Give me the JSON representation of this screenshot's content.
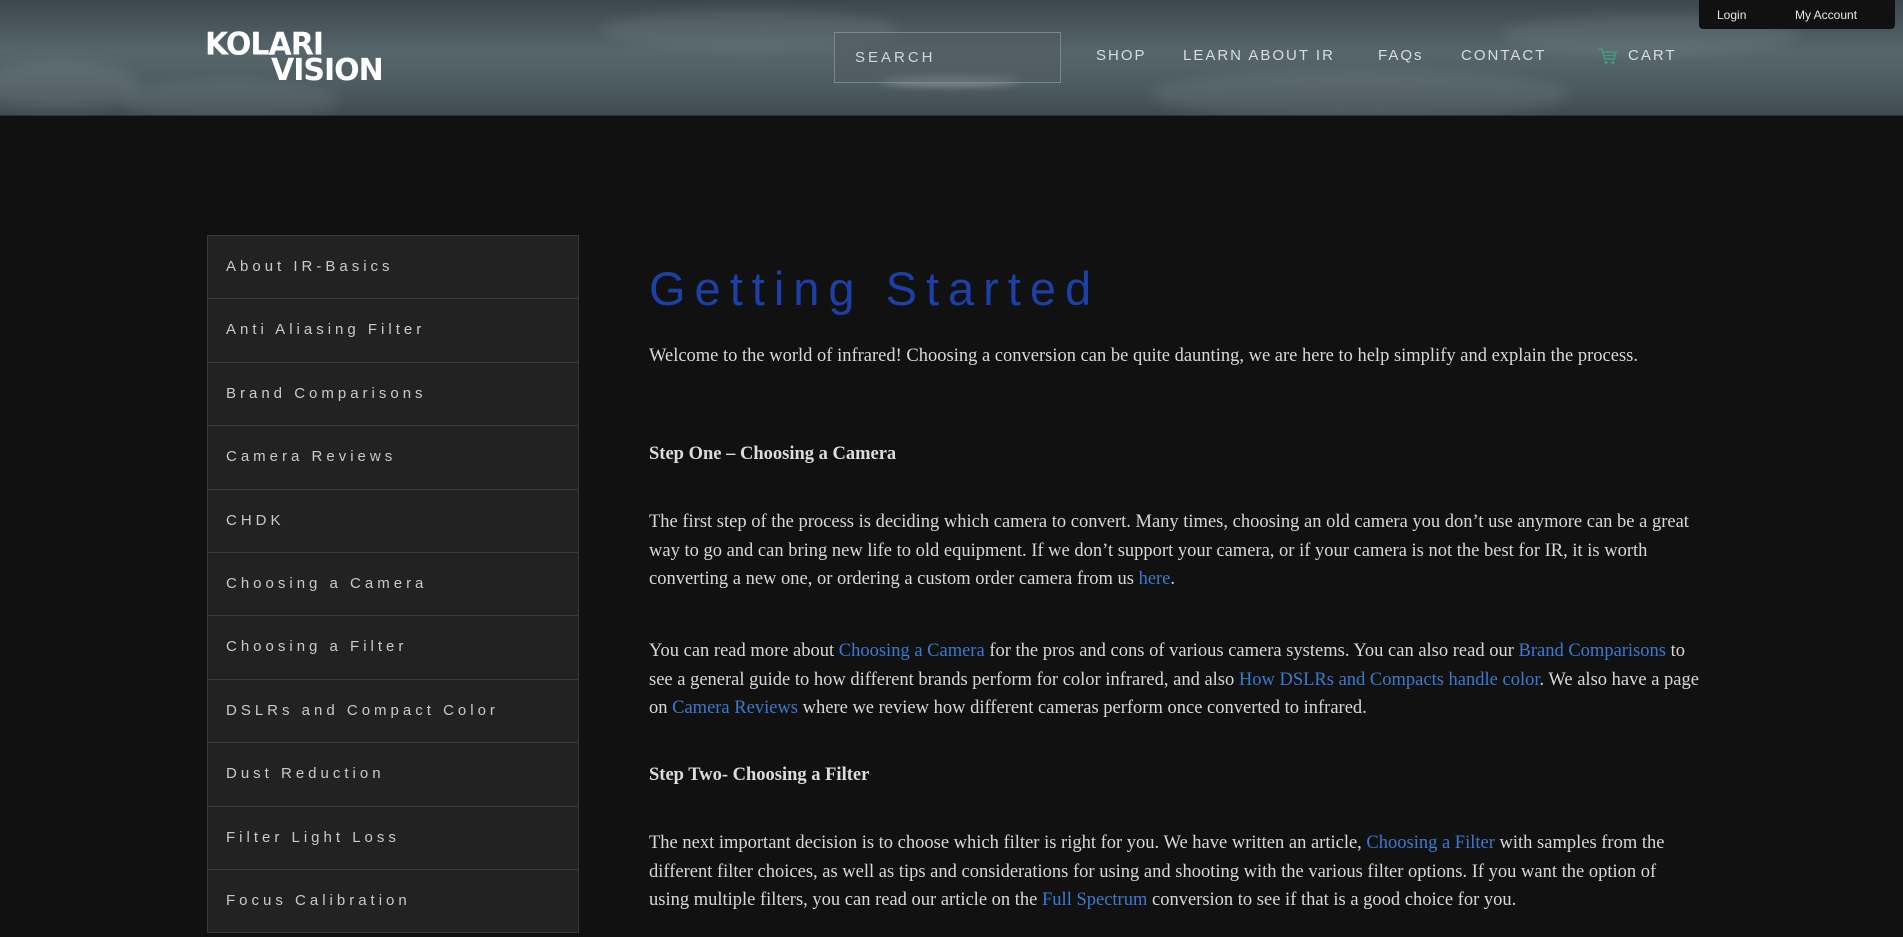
{
  "header": {
    "logo_line1": "KOLARI",
    "logo_line2": "VISION",
    "search_placeholder": "SEARCH",
    "nav": {
      "shop": "SHOP",
      "learn": "LEARN ABOUT IR",
      "faqs": "FAQs",
      "contact": "CONTACT",
      "cart": "CART"
    },
    "account": {
      "login": "Login",
      "my_account": "My Account"
    },
    "icons": {
      "cart": "cart-icon"
    }
  },
  "sidebar": {
    "items": [
      {
        "label": "About IR-Basics"
      },
      {
        "label": "Anti Aliasing Filter"
      },
      {
        "label": "Brand Comparisons"
      },
      {
        "label": "Camera Reviews"
      },
      {
        "label": "CHDK"
      },
      {
        "label": "Choosing a Camera"
      },
      {
        "label": "Choosing a Filter"
      },
      {
        "label": "DSLRs and Compact Color"
      },
      {
        "label": "Dust Reduction"
      },
      {
        "label": "Filter Light Loss"
      },
      {
        "label": "Focus Calibration"
      }
    ]
  },
  "main": {
    "title": "Getting Started",
    "intro": "Welcome to the world of infrared! Choosing a conversion can be quite daunting, we are here to help simplify and explain the process.",
    "step1": {
      "heading": "Step One – Choosing a Camera",
      "p1_text": "The first step of the process is deciding which camera to convert. Many times, choosing an old camera you don’t use anymore can be a great way to go and can bring new life to old equipment. If we don’t support your camera, or if your camera is not the best for IR, it is worth converting a new one, or ordering a custom order camera from us ",
      "p1_link": "here",
      "p1_end": ".",
      "p2_a": "You can read more about ",
      "p2_link1": "Choosing a Camera",
      "p2_b": " for the pros and cons of various camera systems. You can also read our ",
      "p2_link2": "Brand Comparisons",
      "p2_c": " to see a general guide to how different brands perform for color infrared, and also ",
      "p2_link3": "How DSLRs and Compacts handle color",
      "p2_d": ". We also have a page on ",
      "p2_link4": "Camera Reviews",
      "p2_e": " where we review how different cameras perform once converted to infrared."
    },
    "step2": {
      "heading": "Step Two- Choosing a Filter",
      "p1_a": "The next important decision is to choose which filter is right for you. We have written an article, ",
      "p1_link1": "Choosing a Filter",
      "p1_b": " with samples from the different filter choices, as well as tips and considerations for using and shooting with the various filter options. If you want the option of using multiple filters, you can read our article on the ",
      "p1_link2": "Full Spectrum",
      "p1_c": " conversion to see if that is a good choice for you."
    }
  },
  "colors": {
    "title_blue": "#1c40a8",
    "link_blue": "#3a7ad0",
    "cart_green": "#3aa07a",
    "background": "#111111",
    "sidebar_bg": "#222222"
  }
}
